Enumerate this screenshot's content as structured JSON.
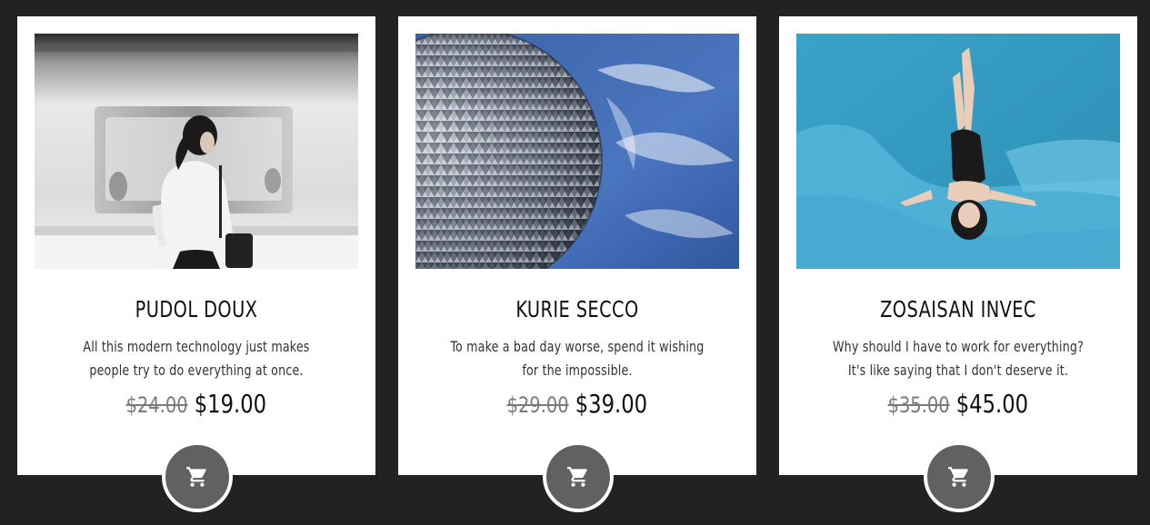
{
  "products": [
    {
      "title": "PUDOL DOUX",
      "description": "All this modern technology just makes people try to do everything at once.",
      "old_price": "$24.00",
      "price": "$19.00",
      "image": "woman-at-subway-photo"
    },
    {
      "title": "KURIE SECCO",
      "description": "To make a bad day worse, spend it wishing for the impossible.",
      "old_price": "$29.00",
      "price": "$39.00",
      "image": "geodesic-sphere-photo"
    },
    {
      "title": "ZOSAISAN INVEC",
      "description": "Why should I have to work for everything? It's like saying that I don't deserve it.",
      "old_price": "$35.00",
      "price": "$45.00",
      "image": "woman-in-pool-photo"
    }
  ],
  "cart_icon": "shopping-cart-icon",
  "colors": {
    "background": "#222222",
    "card": "#ffffff",
    "cart_button": "#616161",
    "old_price": "#7a7a7a"
  }
}
